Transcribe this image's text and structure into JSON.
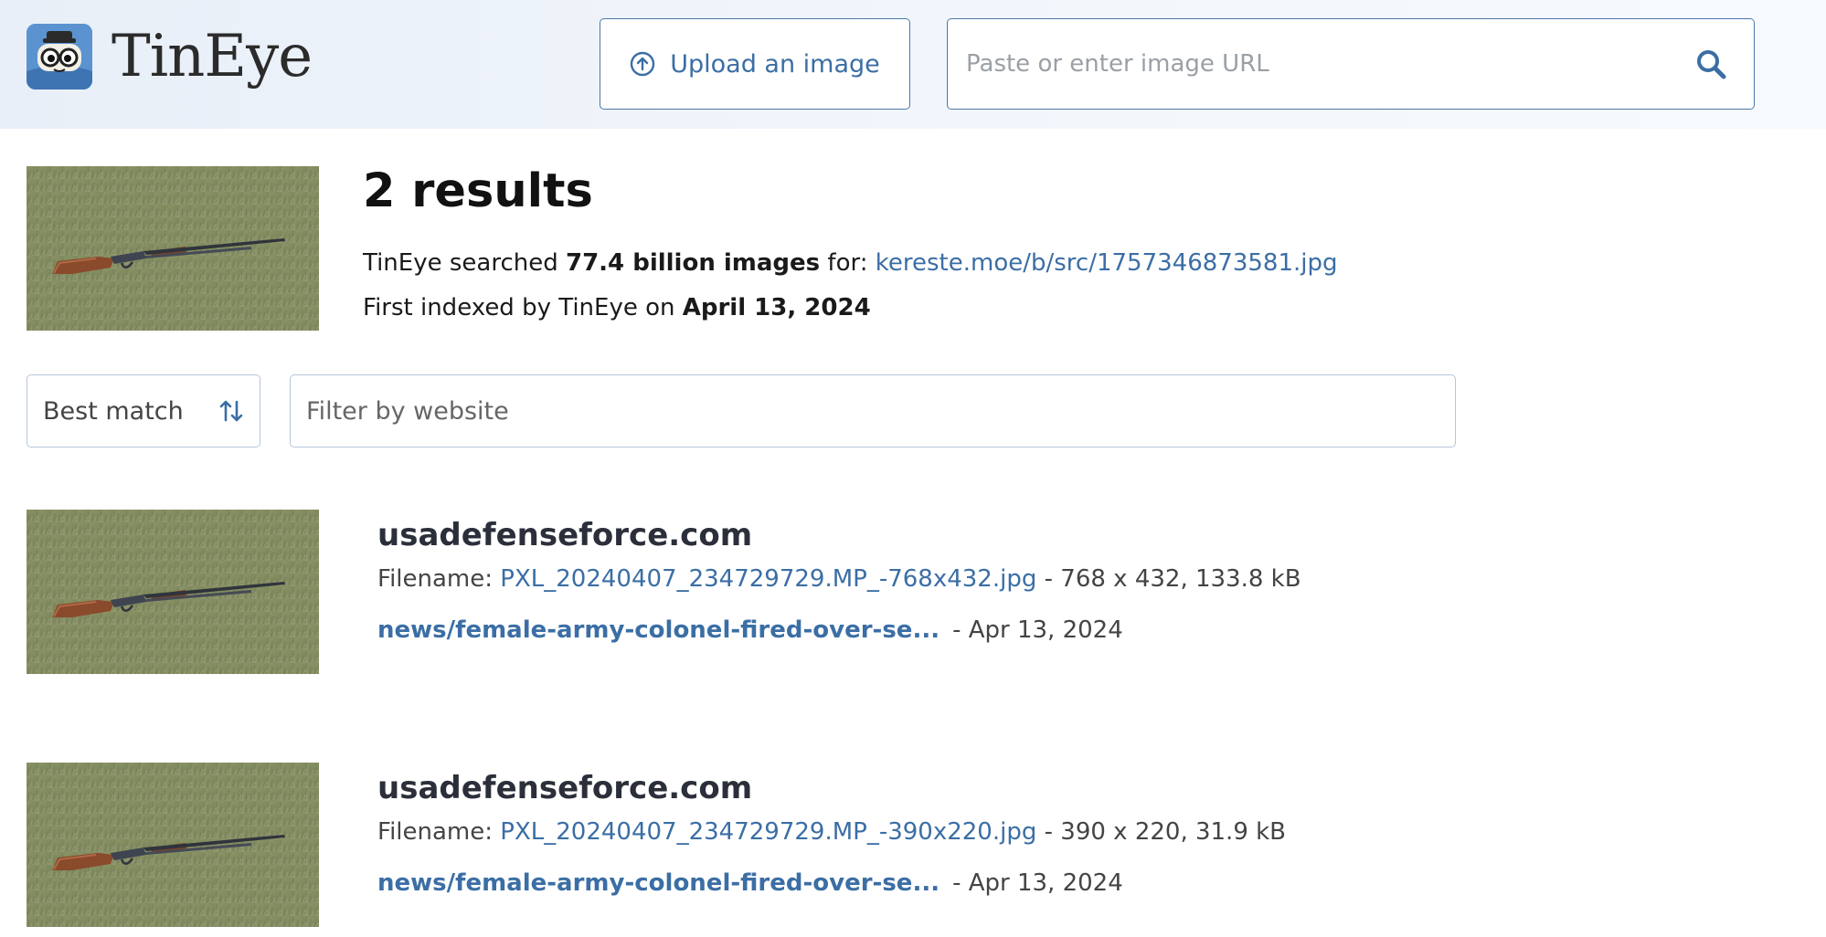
{
  "header": {
    "logo_text": "TinEye",
    "upload_label": "Upload an image",
    "url_placeholder": "Paste or enter image URL"
  },
  "summary": {
    "results_title": "2 results",
    "searched_prefix": "TinEye searched ",
    "searched_count": "77.4 billion images",
    "searched_for": " for: ",
    "query_url": "kereste.moe/b/src/1757346873581.jpg",
    "indexed_prefix": "First indexed by TinEye on ",
    "indexed_date": "April 13, 2024"
  },
  "controls": {
    "sort_label": "Best match",
    "filter_placeholder": "Filter by website"
  },
  "results": [
    {
      "domain": "usadefenseforce.com",
      "filename_label": "Filename: ",
      "filename": "PXL_20240407_234729729.MP_-768x432.jpg",
      "file_meta": " - 768 x 432, 133.8 kB",
      "page_link": "news/female-army-colonel-fired-over-se...",
      "date": "- Apr 13, 2024"
    },
    {
      "domain": "usadefenseforce.com",
      "filename_label": "Filename: ",
      "filename": "PXL_20240407_234729729.MP_-390x220.jpg",
      "file_meta": " - 390 x 220, 31.9 kB",
      "page_link": "news/female-army-colonel-fired-over-se...",
      "date": "- Apr 13, 2024"
    }
  ],
  "colors": {
    "link": "#3b6ea5",
    "border": "#4a78a8",
    "header_bg": "#eef3fa"
  },
  "icons": {
    "logo": "tineye-robot-icon",
    "upload": "upload-circle-arrow-icon",
    "search": "magnifier-icon",
    "sort": "sort-arrows-icon"
  }
}
